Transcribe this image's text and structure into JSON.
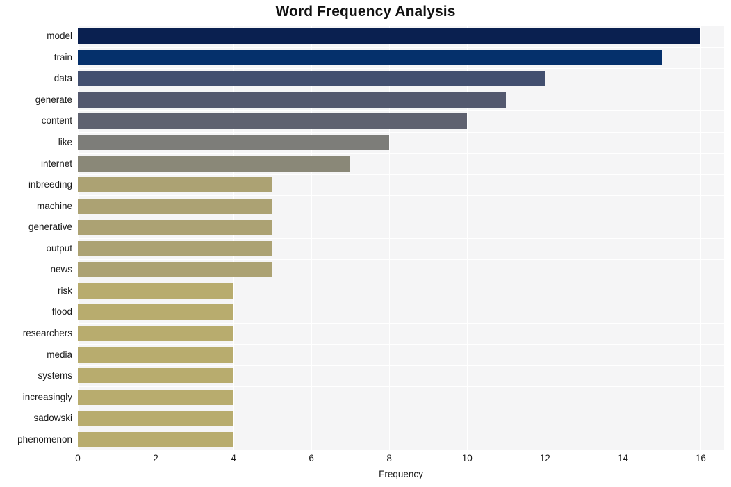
{
  "chart_data": {
    "type": "bar",
    "orientation": "horizontal",
    "title": "Word Frequency Analysis",
    "xlabel": "Frequency",
    "ylabel": "",
    "xlim": [
      0,
      16.6
    ],
    "xticks": [
      0,
      2,
      4,
      6,
      8,
      10,
      12,
      14,
      16
    ],
    "grid": true,
    "legend": null,
    "categories": [
      "model",
      "train",
      "data",
      "generate",
      "content",
      "like",
      "internet",
      "inbreeding",
      "machine",
      "generative",
      "output",
      "news",
      "risk",
      "flood",
      "researchers",
      "media",
      "systems",
      "increasingly",
      "sadowski",
      "phenomenon"
    ],
    "values": [
      16,
      15,
      12,
      11,
      10,
      8,
      7,
      5,
      5,
      5,
      5,
      5,
      4,
      4,
      4,
      4,
      4,
      4,
      4,
      4
    ],
    "bar_colors": [
      "#0a2050",
      "#05306b",
      "#424f6f",
      "#53586e",
      "#5f6270",
      "#7d7d79",
      "#8a8878",
      "#aca273",
      "#aca273",
      "#aca273",
      "#aca273",
      "#aca273",
      "#b8ac6e",
      "#b8ac6e",
      "#b8ac6e",
      "#b8ac6e",
      "#b8ac6e",
      "#b8ac6e",
      "#b8ac6e",
      "#b8ac6e"
    ],
    "plot_background": "#f5f5f6",
    "grid_color": "#ffffff",
    "text_color": "#1a1a1a"
  }
}
